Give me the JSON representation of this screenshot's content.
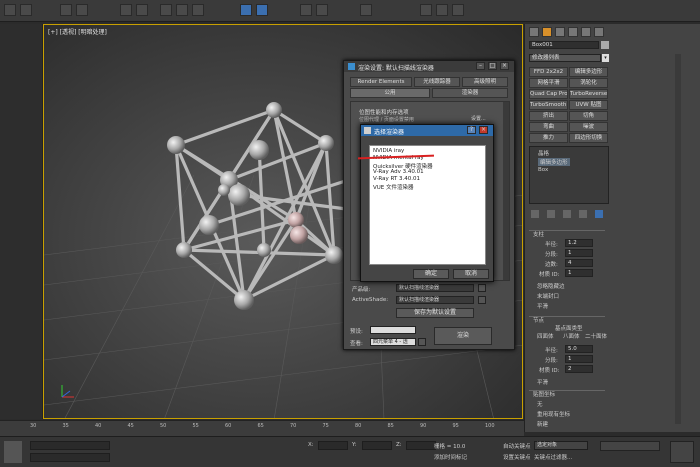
{
  "viewport": {
    "label": "[+] [透视] [明暗处理]"
  },
  "render_setup": {
    "title": "渲染设置: 默认扫描线渲染器",
    "tabs_row1": [
      "Render Elements",
      "光线跟踪器",
      "高级照明"
    ],
    "tabs_row2": [
      "公用",
      "渲染器"
    ],
    "section1": "位图性能和内存选项",
    "section1_sub": "位图代理 / 页面设置禁用",
    "section1_btn": "设置...",
    "production_label": "产品级:",
    "production_value": "默认扫描线渲染器",
    "activeshade_label": "ActiveShade:",
    "activeshade_value": "默认扫描线渲染器",
    "save_default_btn": "保存为默认设置",
    "preset_label": "预设:",
    "preset_value": "",
    "view_label": "查看:",
    "view_value": "四元菜单 4 - 透",
    "render_btn": "渲染"
  },
  "choose_renderer": {
    "title": "选择渲染器",
    "help": "?",
    "items": [
      "NVIDIA iray",
      "NVIDIA mental ray",
      "Quicksilver 硬件渲染器",
      "V-Ray Adv 3.40.01",
      "V-Ray RT 3.40.01",
      "VUE 文件渲染器"
    ],
    "ok": "确定",
    "cancel": "取消"
  },
  "command_panel": {
    "object_name": "Box001",
    "modifier_list": "修改器列表",
    "buttons": [
      [
        "FFD 2x2x2",
        "编辑多边形"
      ],
      [
        "网格平滑",
        "涡轮化"
      ],
      [
        "Quad Cap Pro",
        "TurboReverse"
      ],
      [
        "TurboSmooth Pro",
        "UVW 贴图"
      ],
      [
        "挤出",
        "切角"
      ],
      [
        "弯曲",
        "噪波"
      ],
      [
        "推力",
        "四边形切换"
      ]
    ],
    "stack": [
      "晶格",
      "编辑多边形",
      "Box"
    ],
    "struts_title": "支柱",
    "radius_label": "半径:",
    "radius_value": "1.2",
    "segments_label": "分段:",
    "segments_value": "1",
    "sides_label": "边数:",
    "sides_value": "4",
    "material_label": "材质 ID:",
    "material_value": "1",
    "ignore_hidden": "忽略隐藏边",
    "end_caps": "末端封口",
    "smooth1": "平滑",
    "joints_title": "节点",
    "geodesic_title": "基点面类型",
    "tetra": "四面体",
    "octa": "八面体",
    "icosa": "二十面体",
    "j_radius_label": "半径:",
    "j_radius_value": "5.0",
    "j_segments_label": "分段:",
    "j_segments_value": "1",
    "j_material_label": "材质 ID:",
    "j_material_value": "2",
    "smooth2": "平滑",
    "mapping_title": "贴图坐标",
    "map_none": "无",
    "map_existing": "重用现有坐标",
    "map_new": "新建"
  },
  "timeline": {
    "ticks": [
      "30",
      "35",
      "40",
      "45",
      "50",
      "55",
      "60",
      "65",
      "70",
      "75",
      "80",
      "85",
      "90",
      "95",
      "100"
    ]
  },
  "status": {
    "x_label": "X:",
    "y_label": "Y:",
    "z_label": "Z:",
    "grid": "栅格 = 10.0",
    "add_time_tag": "添加时间标记",
    "autokey": "自动关键点",
    "selected": "选定对象",
    "setkey": "设置关键点",
    "key_filters": "关键点过滤器..."
  }
}
